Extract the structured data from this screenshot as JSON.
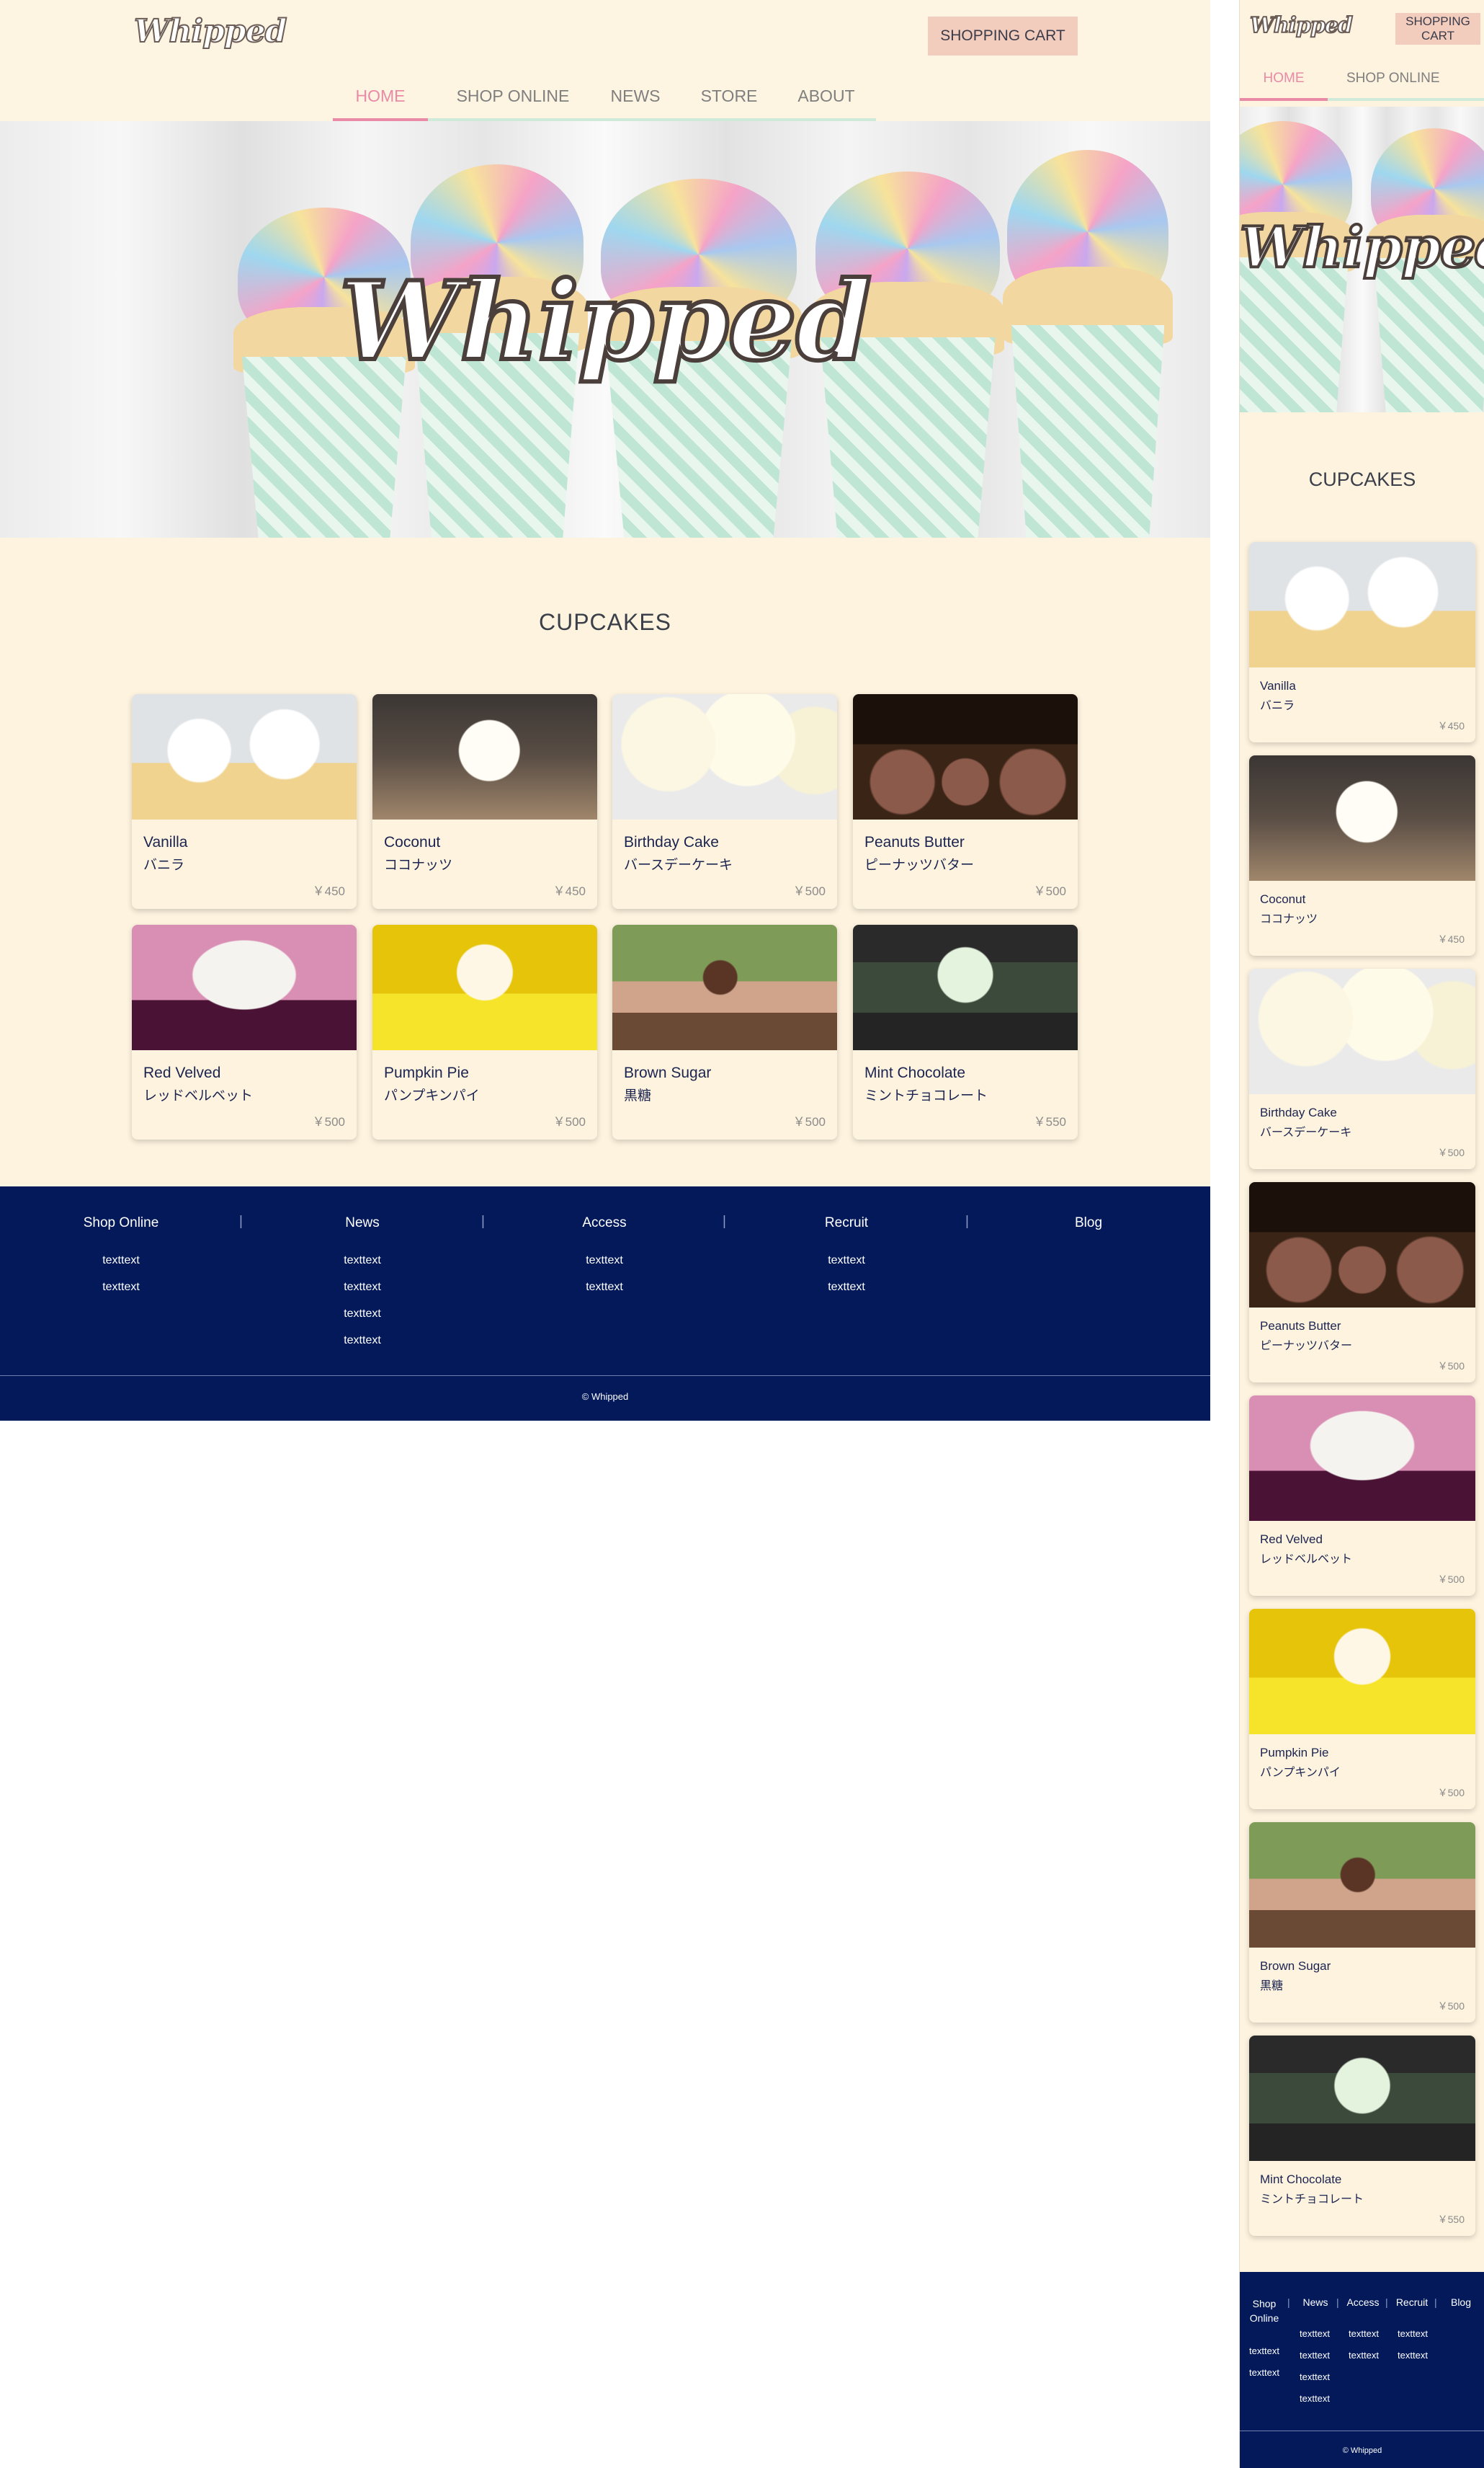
{
  "brand": {
    "logo": "Whipped",
    "hero_logo": "Whipped"
  },
  "header": {
    "cart_label": "SHOPPING CART"
  },
  "nav": {
    "items": [
      "HOME",
      "SHOP ONLINE",
      "NEWS",
      "STORE",
      "ABOUT"
    ],
    "active": "HOME"
  },
  "section": {
    "title": "CUPCAKES"
  },
  "products": [
    {
      "name": "Vanilla",
      "name_ja": "バニラ",
      "price": "￥450",
      "image": "vanilla-cupcake-photo"
    },
    {
      "name": "Coconut",
      "name_ja": "ココナッツ",
      "price": "￥450",
      "image": "coconut-cupcake-photo"
    },
    {
      "name": "Birthday Cake",
      "name_ja": "バースデーケーキ",
      "price": "￥500",
      "image": "birthday-cake-cupcake-photo"
    },
    {
      "name": "Peanuts Butter",
      "name_ja": "ピーナッツバター",
      "price": "￥500",
      "image": "peanut-butter-cupcake-photo"
    },
    {
      "name": "Red Velved",
      "name_ja": "レッドベルベット",
      "price": "￥500",
      "image": "red-velvet-cupcake-photo"
    },
    {
      "name": "Pumpkin Pie",
      "name_ja": "パンプキンパイ",
      "price": "￥500",
      "image": "pumpkin-pie-cupcake-photo"
    },
    {
      "name": "Brown Sugar",
      "name_ja": "黒糖",
      "price": "￥500",
      "image": "brown-sugar-cupcake-photo"
    },
    {
      "name": "Mint Chocolate",
      "name_ja": "ミントチョコレート",
      "price": "￥550",
      "image": "mint-chocolate-cupcake-photo"
    }
  ],
  "footer": {
    "columns": [
      {
        "heading": "Shop Online",
        "links": [
          "texttext",
          "texttext"
        ]
      },
      {
        "heading": "News",
        "links": [
          "texttext",
          "texttext",
          "texttext",
          "texttext"
        ]
      },
      {
        "heading": "Access",
        "links": [
          "texttext",
          "texttext"
        ]
      },
      {
        "heading": "Recruit",
        "links": [
          "texttext",
          "texttext"
        ]
      },
      {
        "heading": "Blog",
        "links": []
      }
    ],
    "separator": "|",
    "copyright": "© Whipped"
  },
  "mobile": {
    "nav_visible": [
      "HOME",
      "SHOP ONLINE"
    ],
    "footer_heading_shop": "Shop\nOnline"
  },
  "colors": {
    "background": "#fdf3df",
    "accent_pink": "#e98aa6",
    "nav_underline": "#cfead9",
    "cart_button": "#f2ccbd",
    "footer": "#03195a",
    "text_dark": "#1c2450"
  }
}
